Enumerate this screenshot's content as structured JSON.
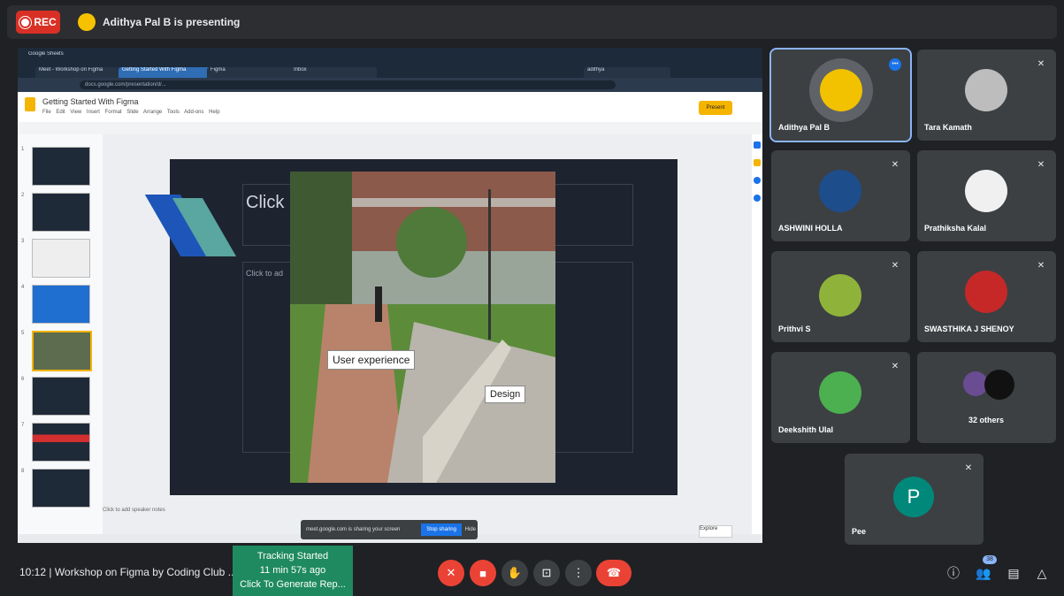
{
  "top_bar": {
    "rec_label": "REC",
    "presenter_text": "Adithya Pal B is presenting"
  },
  "shared_screen": {
    "browser_tabs": [
      "Google Sheets",
      "Getting Started With Figma",
      "Meet - Workshop on Figma",
      "Figma",
      "Inbox",
      "adithya"
    ],
    "url": "docs.google.com/presentation/d/...",
    "doc_title": "Getting Started With Figma",
    "doc_menu": "File Edit View Insert Format Slide Arrange Tools Add-ons Help",
    "present_label": "Present",
    "slide_title": "Click",
    "slide_sub": "Click to ad",
    "photo_label_1": "User experience",
    "photo_label_2": "Design",
    "notes_placeholder": "Click to add speaker notes",
    "share_text": "meet.google.com is sharing your screen",
    "share_stop": "Stop sharing",
    "share_hide": "Hide",
    "explore_label": "Explore",
    "slide_numbers": [
      "1",
      "2",
      "3",
      "4",
      "5",
      "6",
      "7",
      "8"
    ]
  },
  "participants": [
    {
      "name": "Adithya Pal B",
      "color": "#f2c200",
      "active": true
    },
    {
      "name": "Tara Kamath",
      "color": "#bdbdbd",
      "active": false
    },
    {
      "name": "ASHWINI HOLLA",
      "color": "#1e4d8c",
      "active": false
    },
    {
      "name": "Prathiksha Kalal",
      "color": "#f0f0f0",
      "active": false
    },
    {
      "name": "Prithvi S",
      "color": "#8fb33a",
      "active": false
    },
    {
      "name": "SWASTHIKA J SHENOY",
      "color": "#c62828",
      "active": false
    },
    {
      "name": "Deekshith Ulal",
      "color": "#4caf50",
      "active": false
    },
    {
      "name": "32 others",
      "color": "#111111",
      "active": false
    },
    {
      "name": "Pee",
      "initial": "P",
      "color": "#00897b",
      "active": false
    }
  ],
  "bottom_bar": {
    "meeting_info": "10:12 | Workshop on Figma by Coding Club ...",
    "tracking_lines": [
      "Tracking Started",
      "11 min 57s ago",
      "Click To Generate Rep..."
    ],
    "people_count": "38"
  }
}
